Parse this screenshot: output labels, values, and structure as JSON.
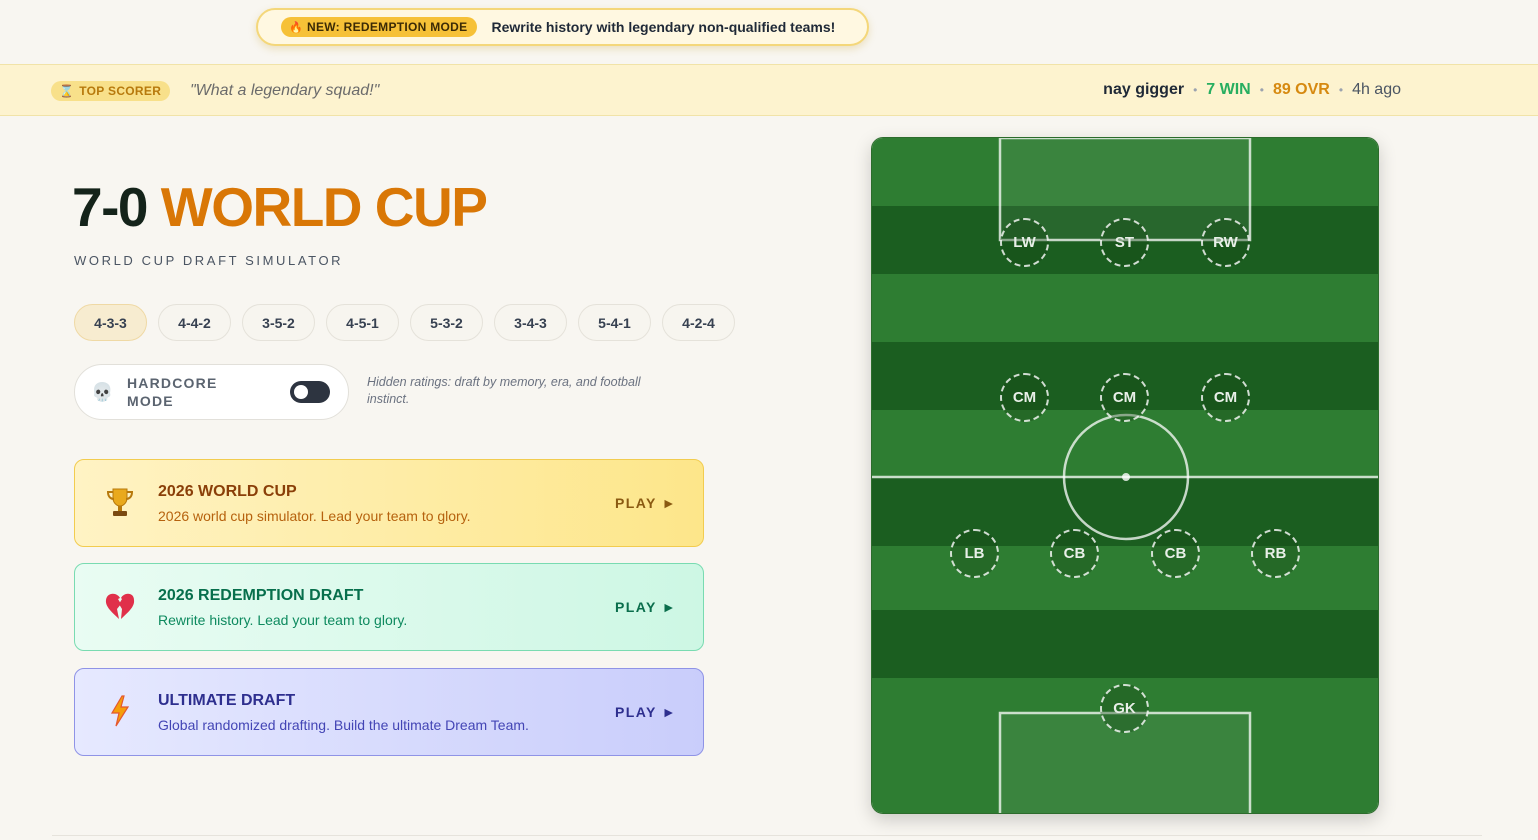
{
  "announcement": {
    "badge": "NEW: REDEMPTION MODE",
    "text": "Rewrite history with legendary non-qualified teams!"
  },
  "top_scorer": {
    "badge": "TOP SCORER",
    "quote": "\"What a legendary squad!\"",
    "name": "nay gigger",
    "wins": "7 WIN",
    "ovr": "89 OVR",
    "time": "4h ago"
  },
  "hero": {
    "title_num": "7-0",
    "title_accent": "WORLD CUP",
    "subtitle": "WORLD CUP DRAFT SIMULATOR"
  },
  "formations": {
    "items": [
      "4-3-3",
      "4-4-2",
      "3-5-2",
      "4-5-1",
      "5-3-2",
      "3-4-3",
      "5-4-1",
      "4-2-4"
    ],
    "selected": "4-3-3"
  },
  "hardcore": {
    "label_line1": "HARDCORE",
    "label_line2": "MODE",
    "enabled": false,
    "note": "Hidden ratings: draft by memory, era, and football instinct."
  },
  "modes": [
    {
      "title": "2026 WORLD CUP",
      "desc": "2026 world cup simulator. Lead your team to glory.",
      "play": "PLAY ►",
      "icon": "trophy-icon"
    },
    {
      "title": "2026 REDEMPTION DRAFT",
      "desc": "Rewrite history. Lead your team to glory.",
      "play": "PLAY ►",
      "icon": "broken-heart-icon"
    },
    {
      "title": "ULTIMATE DRAFT",
      "desc": "Global randomized drafting. Build the ultimate Dream Team.",
      "play": "PLAY ►",
      "icon": "lightning-icon"
    }
  ],
  "pitch": {
    "positions": {
      "lw": "LW",
      "st": "ST",
      "rw": "RW",
      "cm1": "CM",
      "cm2": "CM",
      "cm3": "CM",
      "lb": "LB",
      "cb1": "CB",
      "cb2": "CB",
      "rb": "RB",
      "gk": "GK"
    }
  },
  "colors": {
    "accent": "#d97706",
    "pitch_light": "#2e7d32",
    "pitch_dark": "#1b5e20",
    "win": "#27ae60",
    "ovr": "#d68910"
  }
}
